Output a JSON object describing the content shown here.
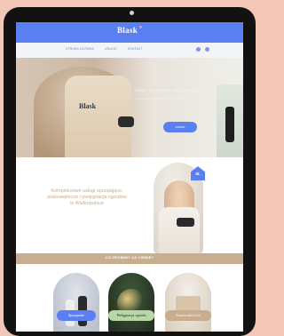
{
  "header": {
    "logo": "Blask",
    "nav_items": [
      "STRONA GŁÓWNA",
      "USŁUGI",
      "KONTAKT"
    ],
    "nav_icons": [
      "phone-icon",
      "mail-icon"
    ]
  },
  "hero": {
    "title": "Blask – profesjonalne usługi sprzątające",
    "subtitle": "Kompleksowe sprzątanie i pielęgnacja ogrodów",
    "button_label": "ZAMÓW"
  },
  "intro": {
    "text": "Kompleksowe usługi sprzątające, prasowalnicze i pielęgnacja ogrodów w Wielkopolsce",
    "badge_label": "BL"
  },
  "section": {
    "title": "CO ZROBIMY ZA CIEBIE?"
  },
  "services": {
    "items": [
      {
        "label": "Sprzątanie"
      },
      {
        "label": "Pielęgnacja ogrodu"
      },
      {
        "label": "Prasowalnictwo"
      }
    ]
  },
  "colors": {
    "brand_blue": "#5a7ff0",
    "beige": "#c8ad8e",
    "green_pill": "#b8d7a6",
    "background": "#f2c7b8"
  }
}
